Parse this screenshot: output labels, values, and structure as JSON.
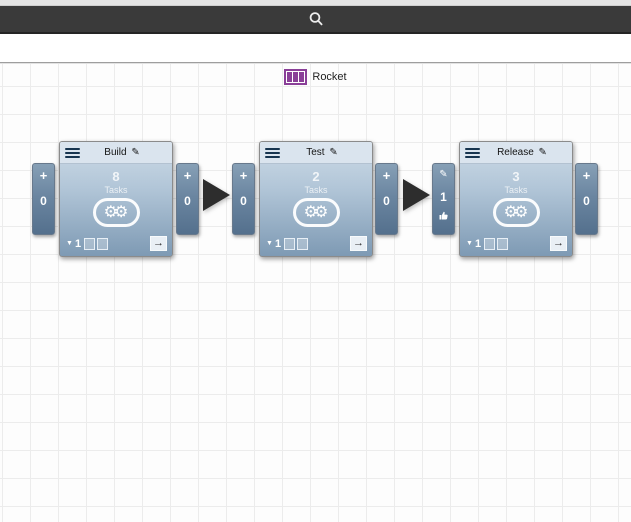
{
  "toolbar": {
    "search_icon": "magnifier"
  },
  "pipeline": {
    "name": "Rocket",
    "icon": "pipeline-stages",
    "accent_color": "#8a3f98"
  },
  "icons": {
    "edit": "✎",
    "collapse": "▼",
    "open_arrow": "→",
    "gears": "⚙⚙"
  },
  "stages": [
    {
      "title": "Build",
      "task_count": "8",
      "tasks_label": "Tasks",
      "footer_count": "1",
      "pre_tab": {
        "plus": "+",
        "count": "0"
      },
      "post_tab": {
        "plus": "+",
        "count": "0"
      }
    },
    {
      "title": "Test",
      "task_count": "2",
      "tasks_label": "Tasks",
      "footer_count": "1",
      "pre_tab": {
        "plus": "+",
        "count": "0"
      },
      "post_tab": {
        "plus": "+",
        "count": "0"
      }
    },
    {
      "title": "Release",
      "task_count": "3",
      "tasks_label": "Tasks",
      "footer_count": "1",
      "pre_tab": {
        "count": "1",
        "approve_icon": "thumb-up"
      },
      "post_tab": {
        "plus": "+",
        "count": "0"
      }
    }
  ]
}
